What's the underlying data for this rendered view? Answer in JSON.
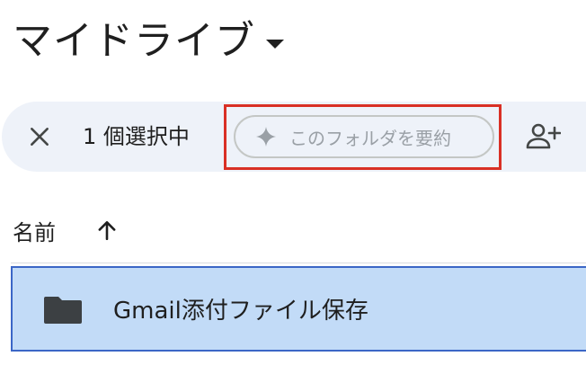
{
  "header": {
    "title": "マイドライブ"
  },
  "toolbar": {
    "selection_count": "1 個選択中",
    "summarize_label": "このフォルダを要約"
  },
  "list": {
    "column_name": "名前",
    "rows": [
      {
        "name": "Gmail添付ファイル保存"
      }
    ]
  },
  "colors": {
    "toolbar_bg": "#eef2f9",
    "selected_row_bg": "#c2dbf7",
    "selected_row_border": "#3b66c6",
    "highlight_box": "#d93025"
  },
  "icons": [
    "close-icon",
    "sparkle-icon",
    "add-person-icon",
    "arrow-up-icon",
    "folder-icon",
    "dropdown-caret-icon"
  ]
}
